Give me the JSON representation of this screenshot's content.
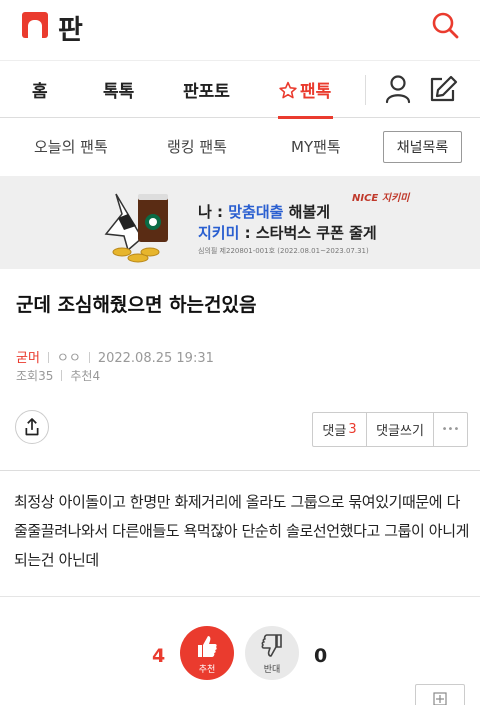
{
  "header": {
    "logo_title": "판"
  },
  "nav": {
    "tabs": [
      {
        "label": "홈"
      },
      {
        "label": "톡톡"
      },
      {
        "label": "판포토"
      },
      {
        "label": "팬톡",
        "active": true
      }
    ]
  },
  "subnav": {
    "items": [
      "오늘의 팬톡",
      "랭킹 팬톡",
      "MY팬톡"
    ],
    "channel_button": "채널목록"
  },
  "banner": {
    "line1_prefix": "나 : ",
    "line1_highlight": "맞춤대출",
    "line1_suffix": " 해볼게",
    "line2_highlight": "지키미",
    "line2_suffix": " : 스타벅스 쿠폰 줄게",
    "fine_print": "심의필 제220801-001호 (2022.08.01~2023.07.31)",
    "brand": "NICE 지키미"
  },
  "post": {
    "title": "군데 조심해줬으면 하는건있음",
    "author": "굳머",
    "author_tag": "ㅇㅇ",
    "datetime": "2022.08.25 19:31",
    "views": "조회35",
    "recommends": "추천4",
    "body": "최정상 아이돌이고 한명만 화제거리에 올라도 그룹으로 묶여있기때문에 다 줄줄끌려나와서 다른애들도 욕먹잖아 단순히 솔로선언했다고 그룹이 아니게 되는건 아닌데"
  },
  "actions": {
    "comment_label": "댓글",
    "comment_count": "3",
    "write_comment": "댓글쓰기",
    "more": "•••"
  },
  "votes": {
    "recommend_count": "4",
    "recommend_label": "추천",
    "oppose_label": "반대",
    "oppose_count": "0"
  },
  "colors": {
    "accent": "#ea3b2e",
    "banner_highlight": "#2a5fd0",
    "banner_bg": "#efefef"
  },
  "icons": [
    "search-icon",
    "star-icon",
    "user-icon",
    "edit-icon",
    "share-icon",
    "thumbs-up-icon",
    "thumbs-down-icon",
    "plus-icon"
  ]
}
